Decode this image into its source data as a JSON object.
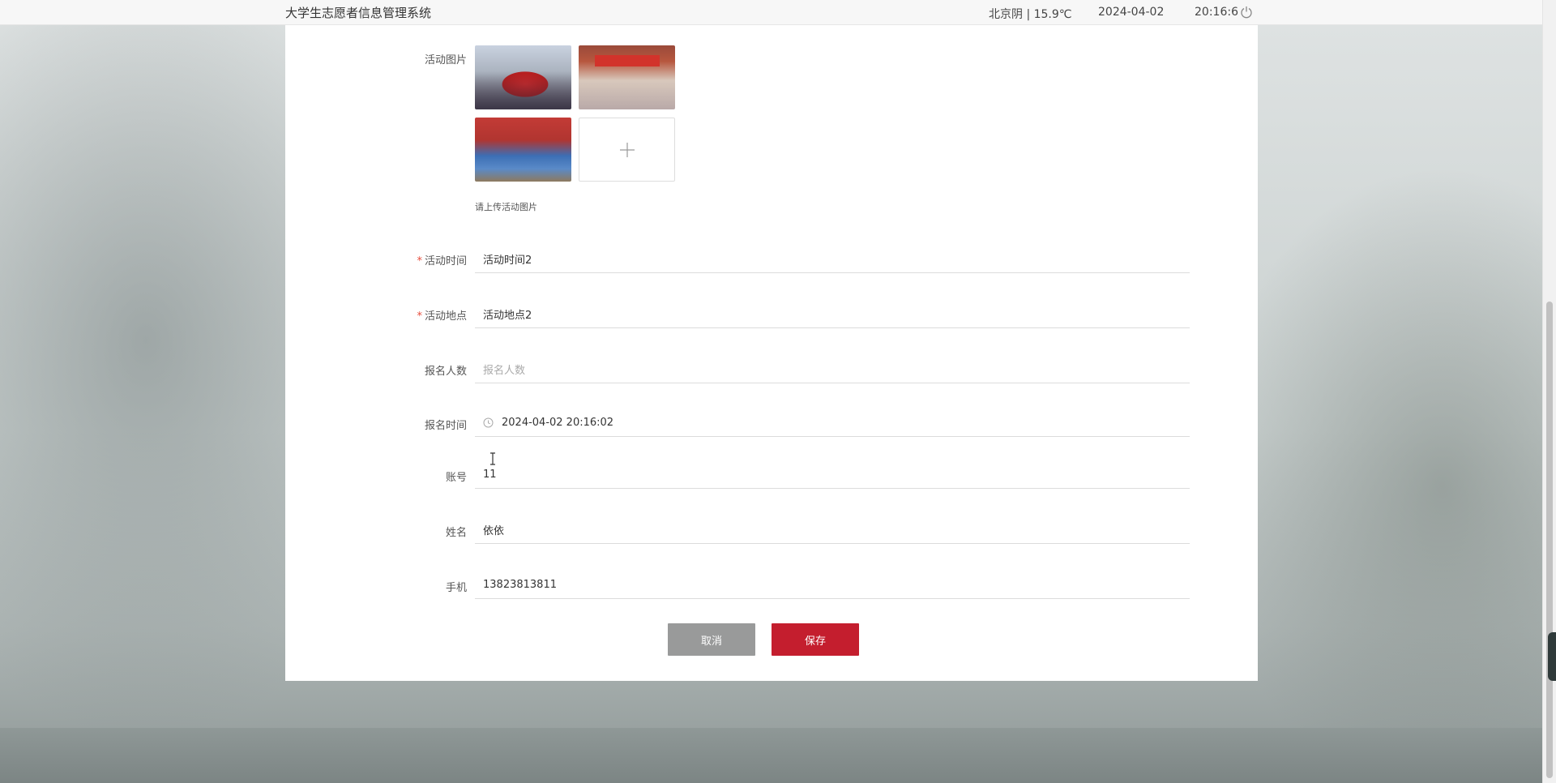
{
  "header": {
    "title": "大学生志愿者信息管理系统",
    "weather": "北京阴 | 15.9℃",
    "date": "2024-04-02",
    "time": "20:16:6"
  },
  "form": {
    "images_label": "活动图片",
    "upload_hint": "请上传活动图片",
    "activity_time_label": "活动时间",
    "activity_time_value": "活动时间2",
    "activity_place_label": "活动地点",
    "activity_place_value": "活动地点2",
    "signup_count_label": "报名人数",
    "signup_count_placeholder": "报名人数",
    "signup_time_label": "报名时间",
    "signup_time_value": "2024-04-02 20:16:02",
    "account_label": "账号",
    "account_value": "11",
    "name_label": "姓名",
    "name_value": "依依",
    "phone_label": "手机",
    "phone_value": "13823813811",
    "required_mark": "*"
  },
  "buttons": {
    "cancel": "取消",
    "save": "保存"
  },
  "colors": {
    "primary": "#c41e2e",
    "cancel": "#999a9a",
    "required": "#e74c3c"
  },
  "icons": [
    "power-icon",
    "plus-icon",
    "clock-icon",
    "text-cursor-icon"
  ]
}
